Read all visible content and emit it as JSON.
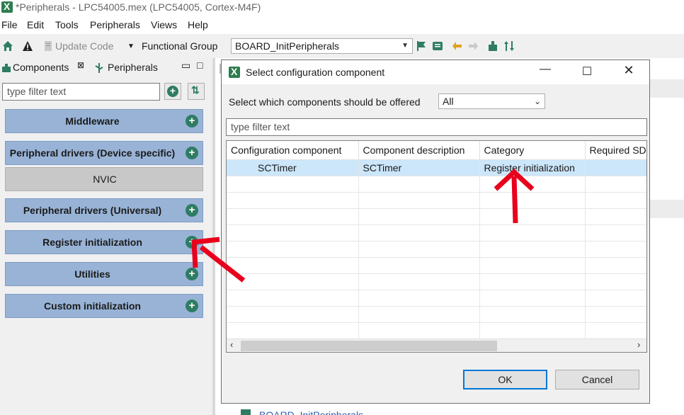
{
  "window": {
    "title": "*Peripherals - LPC54005.mex (LPC54005, Cortex-M4F)"
  },
  "menubar": {
    "items": [
      "File",
      "Edit",
      "Tools",
      "Peripherals",
      "Views",
      "Help"
    ]
  },
  "toolbar": {
    "update_code_label": "Update Code",
    "functional_group_label": "Functional Group",
    "functional_group_value": "BOARD_InitPeripherals"
  },
  "left_panel": {
    "tabs": {
      "components": "Components",
      "peripherals": "Peripherals"
    },
    "filter_placeholder": "type filter text",
    "categories": [
      {
        "label": "Middleware"
      },
      {
        "label": "Peripheral drivers (Device specific)"
      },
      {
        "label": "Peripheral drivers (Universal)"
      },
      {
        "label": "Register initialization"
      },
      {
        "label": "Utilities"
      },
      {
        "label": "Custom initialization"
      }
    ],
    "nvic_label": "NVIC"
  },
  "background": {
    "tree_item_label": "BOARD_InitPeripherals"
  },
  "dialog": {
    "title": "Select configuration component",
    "offered_label": "Select which components should be offered",
    "offered_value": "All",
    "filter_placeholder": "type filter text",
    "columns": [
      "Configuration component",
      "Component description",
      "Category",
      "Required SDK"
    ],
    "rows": [
      {
        "component": "SCTimer",
        "description": "SCTimer",
        "category": "Register initialization",
        "required_sdk": ""
      }
    ],
    "ok_label": "OK",
    "cancel_label": "Cancel"
  },
  "colors": {
    "category_button": "#98b3d6",
    "plus_icon": "#2e7d63",
    "selected_row": "#cce6fa",
    "annotation_arrow": "#e8001c",
    "default_button_border": "#0078d7"
  }
}
